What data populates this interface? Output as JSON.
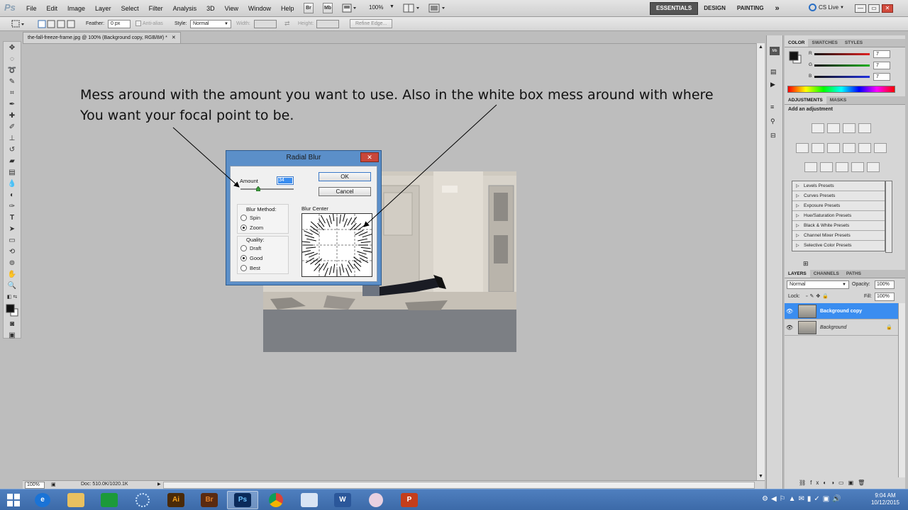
{
  "app": {
    "logo": "Ps",
    "menus": [
      "File",
      "Edit",
      "Image",
      "Layer",
      "Select",
      "Filter",
      "Analysis",
      "3D",
      "View",
      "Window",
      "Help"
    ],
    "toolbar_buttons": [
      "Br",
      "Mb"
    ],
    "zoom": "100%",
    "workspaces": [
      "ESSENTIALS",
      "DESIGN",
      "PAINTING"
    ],
    "more_workspaces": "»",
    "cs_live": "CS Live",
    "window_controls": {
      "minimize": "—",
      "restore": "▭",
      "close": "✕"
    }
  },
  "options_bar": {
    "feather_label": "Feather:",
    "feather_value": "0 px",
    "antialias_label": "Anti-alias",
    "style_label": "Style:",
    "style_value": "Normal",
    "width_label": "Width:",
    "height_label": "Height:",
    "refine_edge": "Refine Edge..."
  },
  "document": {
    "tab_title": "the-fall-freeze-frame.jpg @ 100% (Background copy, RGB/8#) *",
    "status_zoom": "100%",
    "doc_info": "Doc: 510.0K/1020.1K"
  },
  "annotation": {
    "line1": "Mess around with the amount you want to use. Also in the white box mess around with where",
    "line2": "You want your focal point to be."
  },
  "dialog": {
    "title": "Radial Blur",
    "close": "✕",
    "amount_label": "Amount",
    "amount_value": "34",
    "ok": "OK",
    "cancel": "Cancel",
    "blur_method_label": "Blur Method:",
    "blur_methods": [
      {
        "label": "Spin",
        "checked": false
      },
      {
        "label": "Zoom",
        "checked": true
      }
    ],
    "quality_label": "Quality:",
    "qualities": [
      {
        "label": "Draft",
        "checked": false
      },
      {
        "label": "Good",
        "checked": true
      },
      {
        "label": "Best",
        "checked": false
      }
    ],
    "blur_center_label": "Blur Center"
  },
  "color_panel": {
    "tabs": [
      "COLOR",
      "SWATCHES",
      "STYLES"
    ],
    "channels": [
      {
        "name": "R",
        "value": "7",
        "color": "#d42020"
      },
      {
        "name": "G",
        "value": "7",
        "color": "#20a020"
      },
      {
        "name": "B",
        "value": "7",
        "color": "#2030d0"
      }
    ]
  },
  "adjustments_panel": {
    "tabs": [
      "ADJUSTMENTS",
      "MASKS"
    ],
    "heading": "Add an adjustment",
    "presets": [
      "Levels Presets",
      "Curves Presets",
      "Exposure Presets",
      "Hue/Saturation Presets",
      "Black & White Presets",
      "Channel Mixer Presets",
      "Selective Color Presets"
    ]
  },
  "layers_panel": {
    "tabs": [
      "LAYERS",
      "CHANNELS",
      "PATHS"
    ],
    "blend_mode": "Normal",
    "opacity_label": "Opacity:",
    "opacity_value": "100%",
    "lock_label": "Lock:",
    "fill_label": "Fill:",
    "fill_value": "100%",
    "layers": [
      {
        "name": "Background copy",
        "selected": true
      },
      {
        "name": "Background",
        "selected": false
      }
    ]
  },
  "taskbar": {
    "apps": [
      {
        "label": "e",
        "color": "#1a73d6",
        "name": "internet-explorer-icon"
      },
      {
        "label": "",
        "color": "#e8c060",
        "name": "file-explorer-icon"
      },
      {
        "label": "",
        "color": "#1c9a3a",
        "name": "store-icon"
      },
      {
        "label": "",
        "color": "#3a7fd0",
        "name": "settings-app-icon"
      },
      {
        "label": "Ai",
        "color": "#4a2a08",
        "name": "illustrator-icon"
      },
      {
        "label": "Br",
        "color": "#5a2a10",
        "name": "bridge-icon"
      },
      {
        "label": "Ps",
        "color": "#0a2a5a",
        "name": "photoshop-icon"
      },
      {
        "label": "",
        "color": "#e0e0e0",
        "name": "chrome-icon"
      },
      {
        "label": "",
        "color": "#d8e4f4",
        "name": "remote-desktop-icon"
      },
      {
        "label": "W",
        "color": "#2b579a",
        "name": "word-icon"
      },
      {
        "label": "",
        "color": "#e8d0e0",
        "name": "snipping-tool-icon"
      },
      {
        "label": "P",
        "color": "#c43e1c",
        "name": "powerpoint-icon"
      }
    ],
    "time": "9:04 AM",
    "date": "10/12/2015"
  }
}
